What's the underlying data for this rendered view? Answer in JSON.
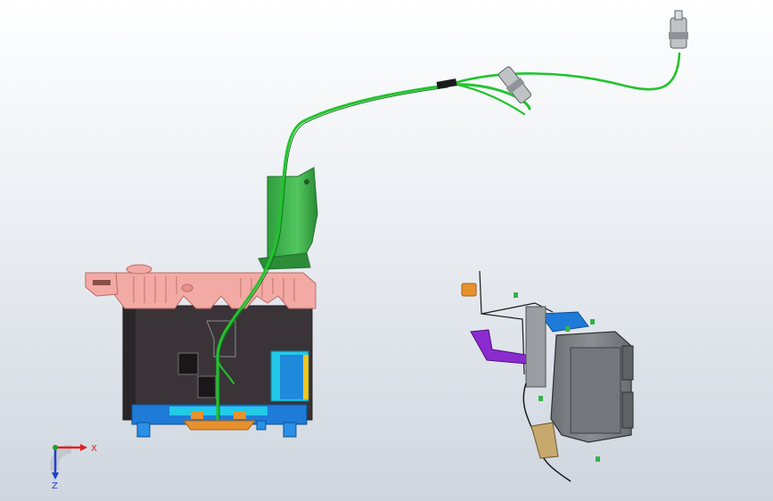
{
  "viewport": {
    "background_top": "#ffffff",
    "background_bottom": "#cfd6df"
  },
  "colors": {
    "cable": "#22c32e",
    "cable_dark": "#0e7a19",
    "housing_pink": "#f4aaa4",
    "housing_pink_dark": "#c97b75",
    "body_dark": "#3a3438",
    "bracket_green": "#36b24a",
    "blue_part": "#1e7bd8",
    "cyan_part": "#23c9e8",
    "orange_part": "#e8922e",
    "ecu_gray": "#7b7e82",
    "purple_part": "#8a2bd0",
    "axis_x": "#e02020",
    "axis_y": "#20a020",
    "axis_z": "#2040d0"
  },
  "triad": {
    "x_label": "X",
    "z_label": "Z"
  },
  "icons": {
    "orientation_triad": "orientation-triad-icon"
  }
}
